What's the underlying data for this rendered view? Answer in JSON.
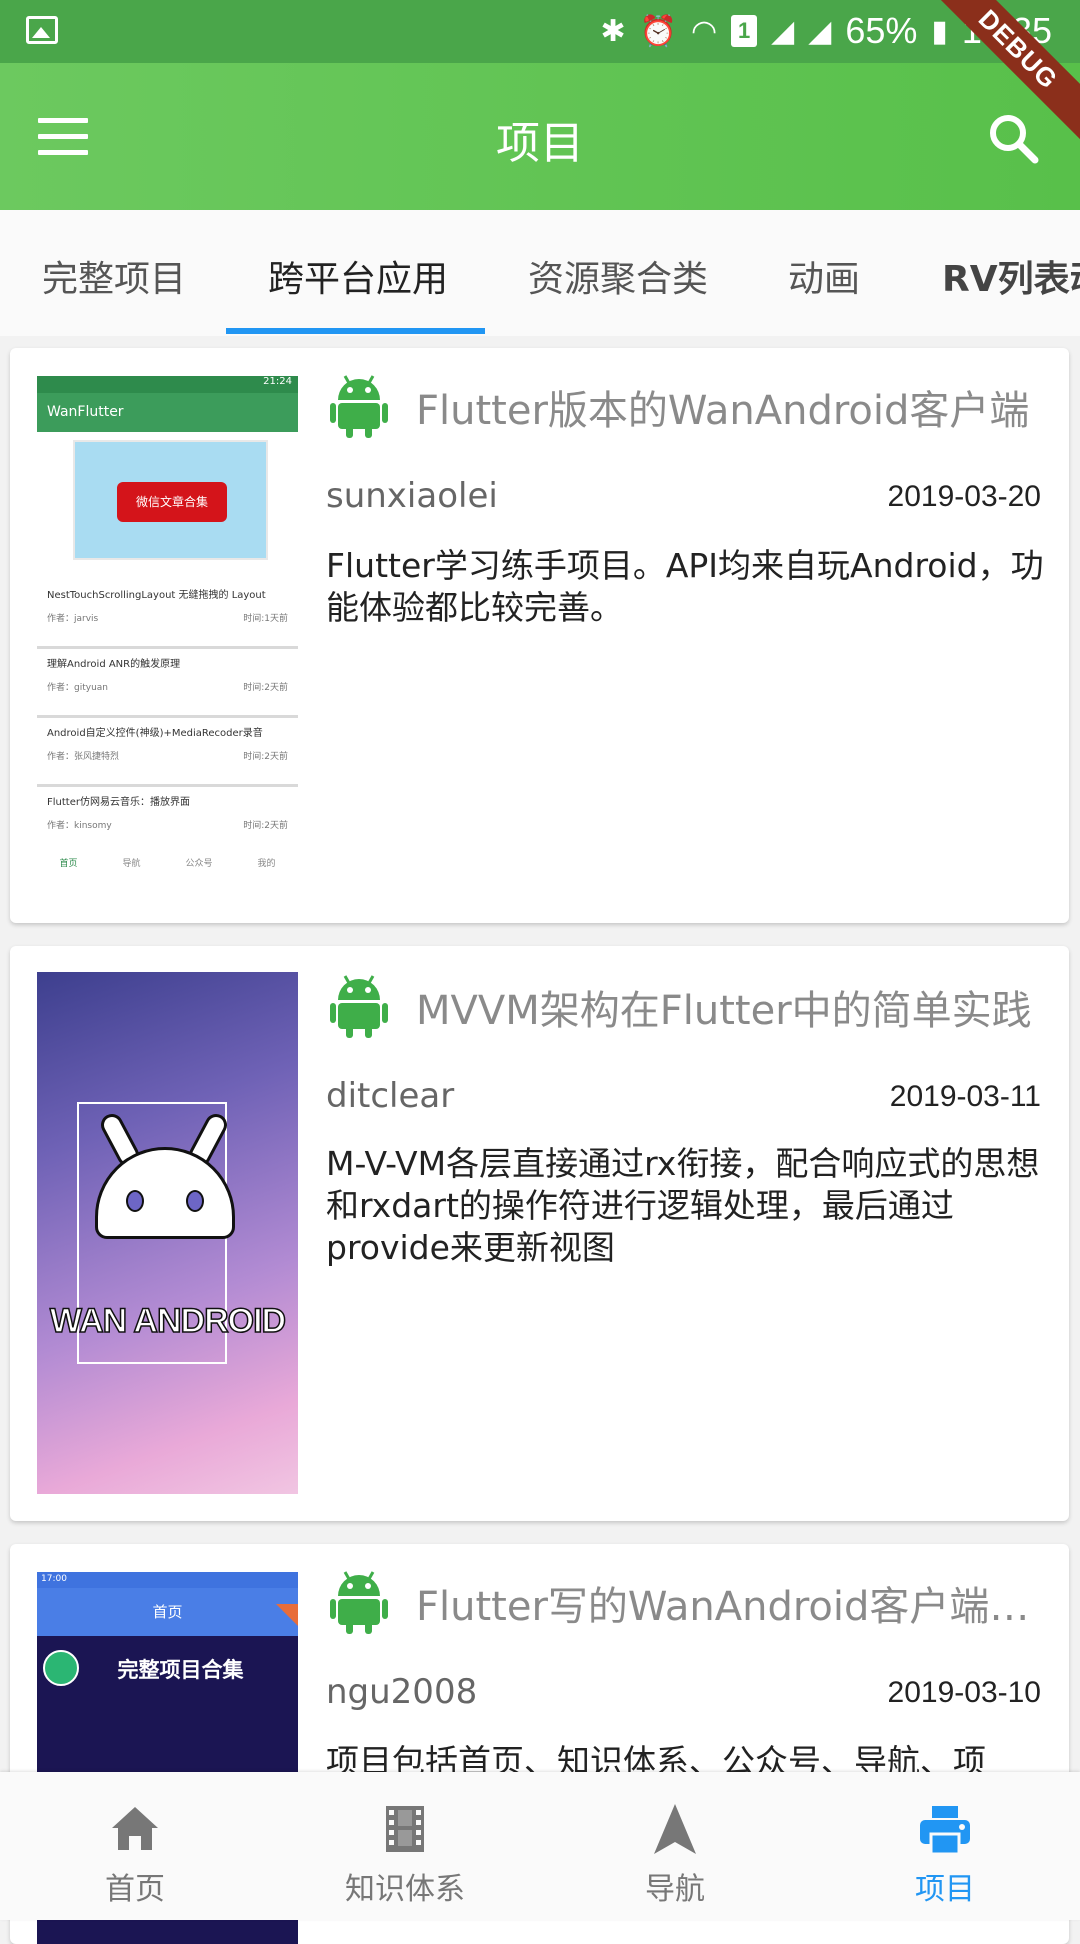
{
  "status_bar": {
    "battery": "65%",
    "time": "17:35",
    "sim": "1",
    "debug_label": "DEBUG"
  },
  "app_bar": {
    "title": "项目"
  },
  "tabs": [
    {
      "label": "完整项目"
    },
    {
      "label": "跨平台应用",
      "active": true
    },
    {
      "label": "资源聚合类"
    },
    {
      "label": "动画"
    },
    {
      "label": "RV列表动"
    }
  ],
  "projects": [
    {
      "title": "Flutter版本的WanAndroid客户端",
      "author": "sunxiaolei",
      "date": "2019-03-20",
      "desc": "Flutter学习练手项目。API均来自玩Android，功能体验都比较完善。",
      "thumb": {
        "status_time": "21:24",
        "app_name": "WanFlutter",
        "banner_text": "微信文章合集",
        "items": [
          {
            "title": "NestTouchScrollingLayout 无缝拖拽的 Layout",
            "author": "作者：jarvis",
            "time": "时间:1天前"
          },
          {
            "title": "理解Android ANR的触发原理",
            "author": "作者：gityuan",
            "time": "时间:2天前"
          },
          {
            "title": "Android自定义控件(神级)+MediaRecoder录音",
            "author": "作者：张风捷特烈",
            "time": "时间:2天前"
          },
          {
            "title": "Flutter仿网易云音乐：播放界面",
            "author": "作者：kinsomy",
            "time": "时间:2天前"
          }
        ],
        "nav": [
          "首页",
          "导航",
          "公众号",
          "我的"
        ]
      }
    },
    {
      "title": "MVVM架构在Flutter中的简单实践",
      "author": "ditclear",
      "date": "2019-03-11",
      "desc": "M-V-VM各层直接通过rx衔接，配合响应式的思想和rxdart的操作符进行逻辑处理，最后通过provide来更新视图",
      "thumb": {
        "logo_text": "WAN ANDROID"
      }
    },
    {
      "title": "Flutter写的WanAndroid客户端应...",
      "author": "ngu2008",
      "date": "2019-03-10",
      "desc": "项目包括首页、知识体系、公众号、导航、项",
      "thumb": {
        "status_time": "17:00",
        "bar_title": "首页",
        "headline": "完整项目合集"
      }
    }
  ],
  "bottom_nav": [
    {
      "label": "首页",
      "icon": "home-icon"
    },
    {
      "label": "知识体系",
      "icon": "film-icon"
    },
    {
      "label": "导航",
      "icon": "navigation-arrow-icon"
    },
    {
      "label": "项目",
      "icon": "printer-icon",
      "active": true
    }
  ],
  "colors": {
    "primary": "#58c04a",
    "accent": "#2196f3",
    "android_green": "#3fae49"
  }
}
